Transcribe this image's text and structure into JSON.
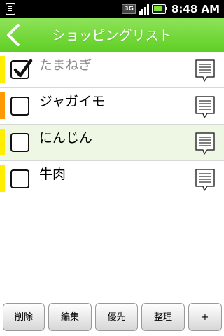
{
  "status_bar": {
    "network": "3G",
    "time": "8:48 AM",
    "icons": [
      "sd-card-icon",
      "network-3g-icon",
      "signal-icon",
      "battery-icon"
    ]
  },
  "header": {
    "title": "ショッピングリスト",
    "back_icon": "back-arrow-icon"
  },
  "items": [
    {
      "label": "たまねぎ",
      "checked": true,
      "priority_color": "#ffee00"
    },
    {
      "label": "ジャガイモ",
      "checked": false,
      "priority_color": "#ff9900"
    },
    {
      "label": "にんじん",
      "checked": false,
      "priority_color": "#ffee00"
    },
    {
      "label": "牛肉",
      "checked": false,
      "priority_color": "#ffee00"
    }
  ],
  "toolbar": {
    "delete_label": "削除",
    "edit_label": "編集",
    "priority_label": "優先",
    "organize_label": "整理",
    "add_label": "+"
  },
  "colors": {
    "accent": "#6ad42f",
    "highlight_row": "#eef7e4"
  }
}
